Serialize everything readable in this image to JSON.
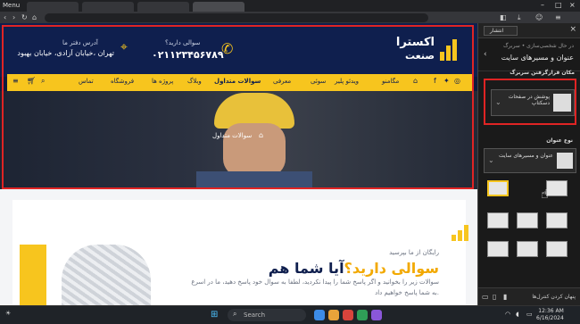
{
  "browser": {
    "menu_label": "Menu",
    "tabs": [
      "",
      "",
      "",
      ""
    ],
    "url": ""
  },
  "site": {
    "logo": {
      "line1": "اکسترا",
      "line2": "صنعت"
    },
    "contact": {
      "phone_label": "سوالی دارید؟",
      "phone": "۰۲۱۱۲۳۴۵۶۷۸۹",
      "address_label": "آدرس دفتر ما",
      "address": "تهران ،خیابان آزادی، خیابان بهبود"
    },
    "nav": [
      {
        "label": "مگامنو",
        "key": "megamenu"
      },
      {
        "label": "ویدئو پلیر",
        "key": "videoplayer"
      },
      {
        "label": "سوئی",
        "key": "item3"
      },
      {
        "label": "معرفی",
        "key": "about"
      },
      {
        "label": "سوالات متداول",
        "key": "faq"
      },
      {
        "label": "وبلاگ",
        "key": "blog"
      },
      {
        "label": "پروژه ها",
        "key": "projects"
      },
      {
        "label": "فروشگاه",
        "key": "shop"
      },
      {
        "label": "تماس",
        "key": "contact"
      }
    ],
    "breadcrumb": "سوالات متداول",
    "content": {
      "kicker": "رایگان از ما بپرسید",
      "title_a": "آیا شما هم ",
      "title_b": "سوالی دارید؟",
      "lines": [
        "سوالات زیر را بخوانید و اگر پاسخ شما را پیدا نکردید، لطفا به سوال خود پاسخ دهید، ما در اسرع",
        "به شما پاسخ خواهیم داد."
      ]
    }
  },
  "panel": {
    "publish_label": "انتشار",
    "crumb": "در حال شخصی‌سازی • سربرگ",
    "title": "عنوان و مسیرهای سایت",
    "section_location": "مکان قرارگرفتن سربرگ",
    "location_value": "پوشش در صفحات دسکتاپ",
    "section_type": "نوع عنوان",
    "type_value": "عنوان و مسیرهای سایت",
    "footer_label": "پنهان کردن کنترل‌ها"
  },
  "taskbar": {
    "search_label": "Search",
    "time": "12:36 AM",
    "date": "6/16/2024",
    "accent": "#4cc2ff"
  },
  "colors": {
    "brand_dark": "#0f1f4e",
    "brand_yellow": "#f7c51e",
    "highlight": "#e02424"
  }
}
